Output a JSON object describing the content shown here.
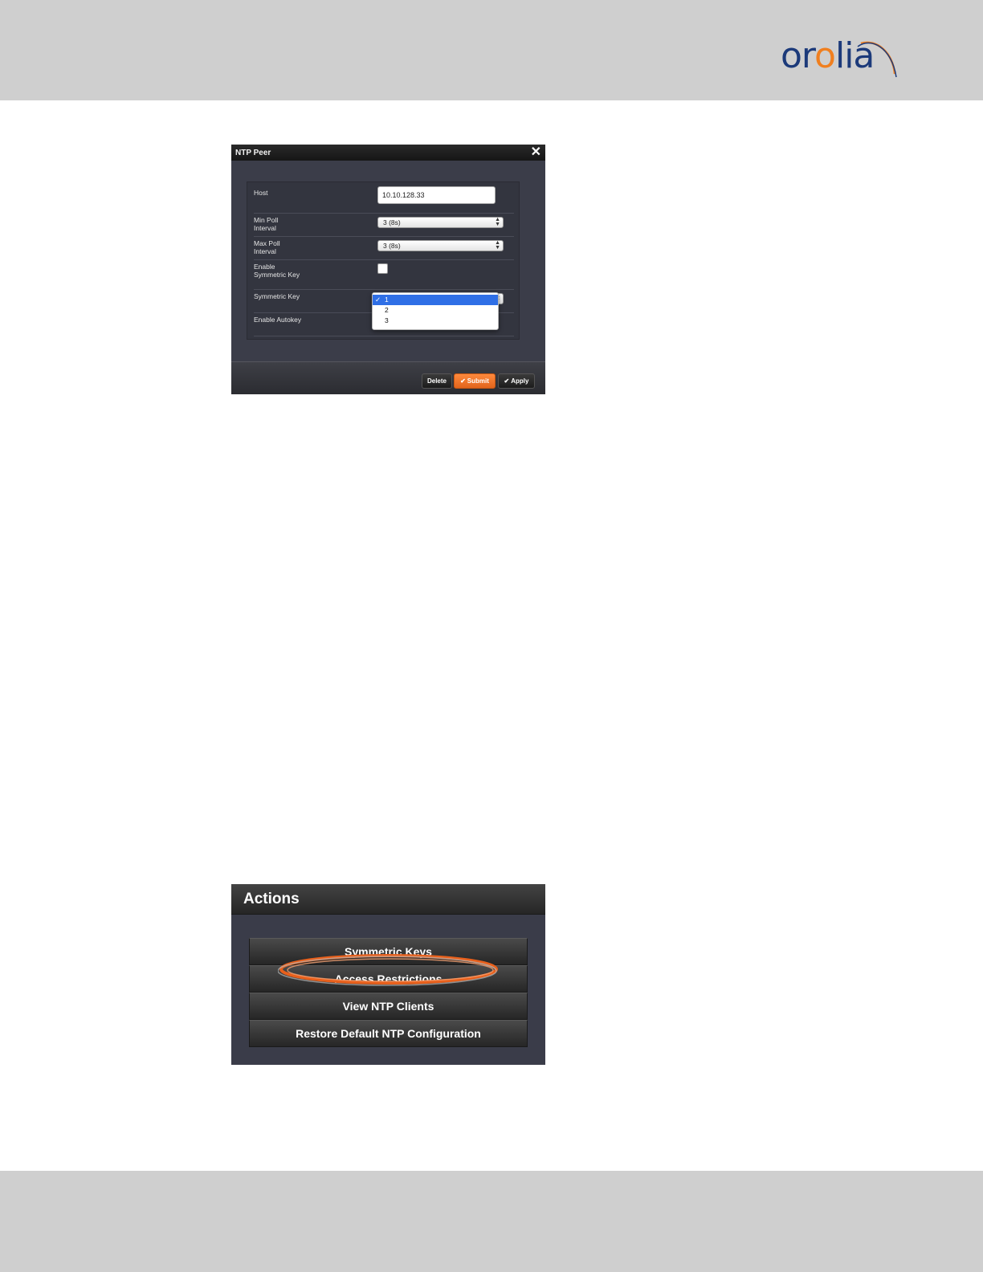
{
  "brand": {
    "logo_text": "orolia",
    "accent_color": "#f07f1f",
    "primary_color": "#1c3a7a"
  },
  "dialog": {
    "title": "NTP Peer",
    "close_icon": "close-icon",
    "fields": {
      "host_label": "Host",
      "host_value": "10.10.128.33",
      "min_poll_label": "Min Poll Interval",
      "min_poll_value": "3 (8s)",
      "max_poll_label": "Max Poll Interval",
      "max_poll_value": "3 (8s)",
      "enable_sym_label": "Enable Symmetric Key",
      "enable_sym_checked": false,
      "sym_key_label": "Symmetric Key",
      "enable_autokey_label": "Enable Autokey"
    },
    "dropdown": {
      "selected": "1",
      "options": [
        "1",
        "2",
        "3"
      ]
    },
    "buttons": {
      "delete": "Delete",
      "submit": "Submit",
      "apply": "Apply"
    }
  },
  "actions": {
    "title": "Actions",
    "items": [
      "Symmetric Keys",
      "Access Restrictions",
      "View NTP Clients",
      "Restore Default NTP Configuration"
    ],
    "highlighted": "Access Restrictions"
  }
}
